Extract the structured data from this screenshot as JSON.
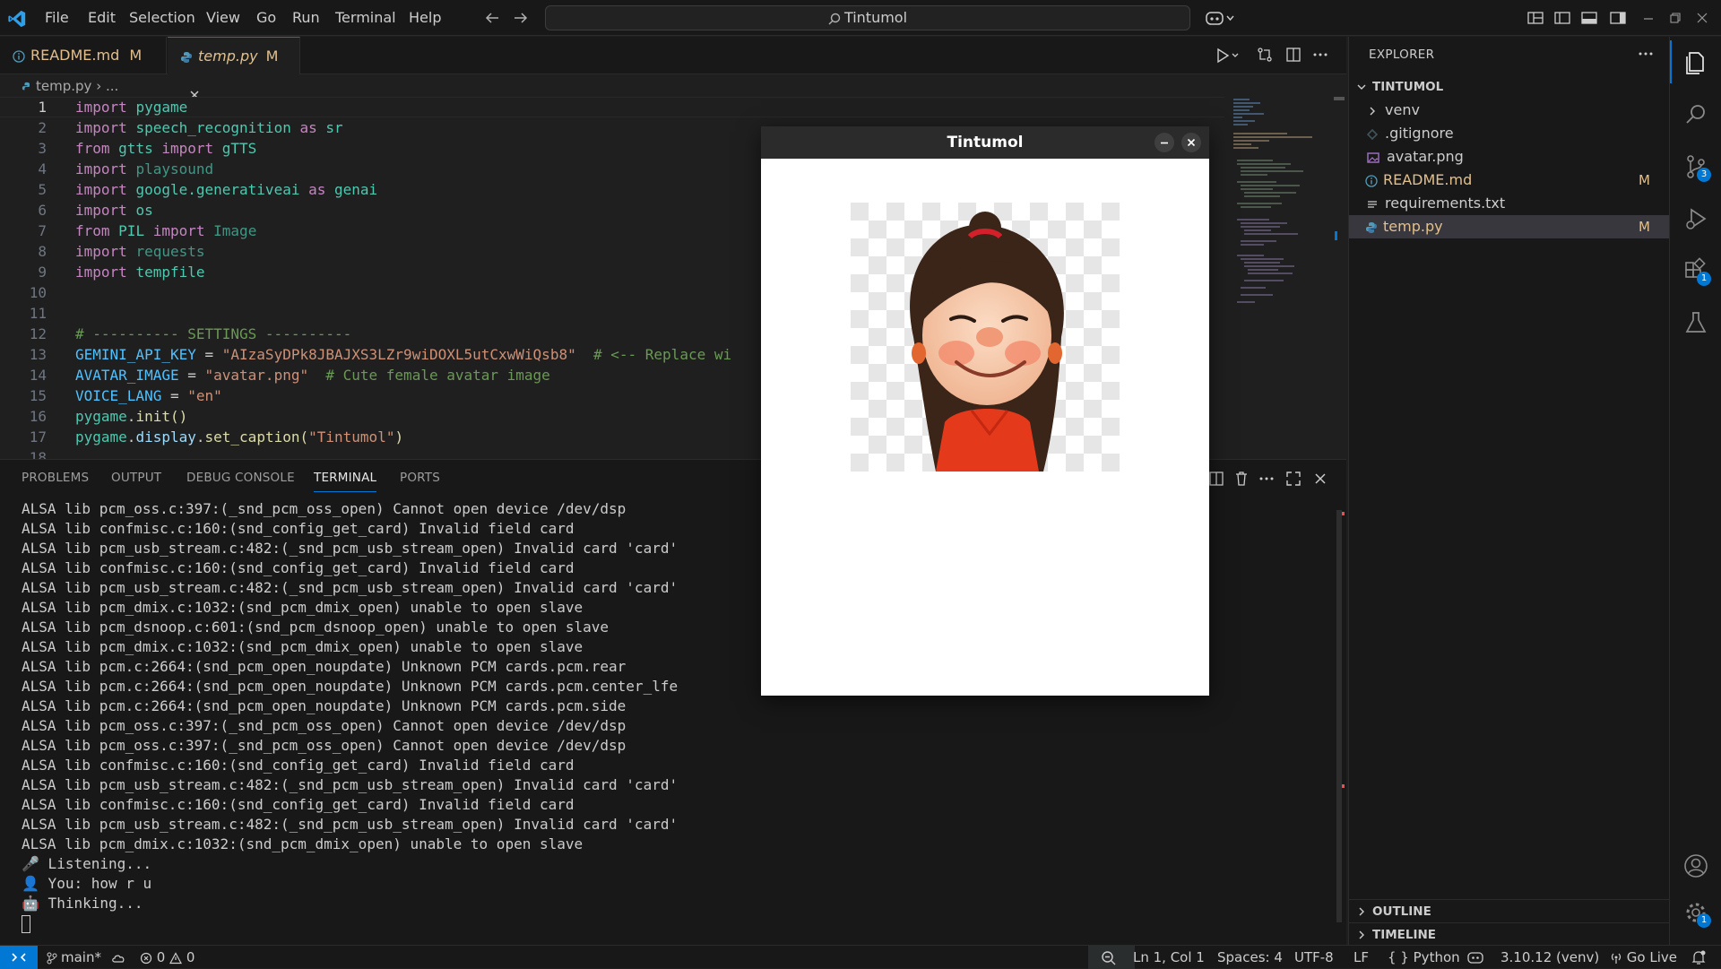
{
  "menu": [
    "File",
    "Edit",
    "Selection",
    "View",
    "Go",
    "Run",
    "Terminal",
    "Help"
  ],
  "command_center": "Tintumol",
  "tabs": [
    {
      "label": "README.md",
      "badge": "M"
    },
    {
      "label": "temp.py",
      "badge": "M"
    }
  ],
  "breadcrumb": {
    "file": "temp.py",
    "rest": "..."
  },
  "code": {
    "lines": [
      "1",
      "2",
      "3",
      "4",
      "5",
      "6",
      "7",
      "8",
      "9",
      "10",
      "11",
      "12",
      "13",
      "14",
      "15",
      "16",
      "17",
      "18"
    ],
    "l1": [
      "import",
      "pygame"
    ],
    "l2": [
      "import",
      "speech_recognition",
      "as",
      "sr"
    ],
    "l3": [
      "from",
      "gtts",
      "import",
      "gTTS"
    ],
    "l4": [
      "import",
      "playsound"
    ],
    "l5": [
      "import",
      "google.generativeai",
      "as",
      "genai"
    ],
    "l6": [
      "import",
      "os"
    ],
    "l7": [
      "from",
      "PIL",
      "import",
      "Image"
    ],
    "l8": [
      "import",
      "requests"
    ],
    "l9": [
      "import",
      "tempfile"
    ],
    "l12": "# ---------- SETTINGS ----------",
    "l13": [
      "GEMINI_API_KEY",
      " = ",
      "\"AIzaSyDPk8JBAJXS3LZr9wiDOXL5utCxwWiQsb8\"",
      "  # <-- Replace wi"
    ],
    "l14": [
      "AVATAR_IMAGE",
      " = ",
      "\"avatar.png\"",
      "  # Cute female avatar image"
    ],
    "l15": [
      "VOICE_LANG",
      " = ",
      "\"en\""
    ],
    "l16": [
      "pygame",
      ".",
      "init",
      "()"
    ],
    "l17": [
      "pygame",
      ".",
      "display",
      ".",
      "set_caption",
      "(",
      "\"Tintumol\"",
      ")"
    ]
  },
  "panel": {
    "tabs": [
      "PROBLEMS",
      "OUTPUT",
      "DEBUG CONSOLE",
      "TERMINAL",
      "PORTS"
    ],
    "terminal": [
      "ALSA lib pcm_oss.c:397:(_snd_pcm_oss_open) Cannot open device /dev/dsp",
      "ALSA lib confmisc.c:160:(snd_config_get_card) Invalid field card",
      "ALSA lib pcm_usb_stream.c:482:(_snd_pcm_usb_stream_open) Invalid card 'card'",
      "ALSA lib confmisc.c:160:(snd_config_get_card) Invalid field card",
      "ALSA lib pcm_usb_stream.c:482:(_snd_pcm_usb_stream_open) Invalid card 'card'",
      "ALSA lib pcm_dmix.c:1032:(snd_pcm_dmix_open) unable to open slave",
      "ALSA lib pcm_dsnoop.c:601:(snd_pcm_dsnoop_open) unable to open slave",
      "ALSA lib pcm_dmix.c:1032:(snd_pcm_dmix_open) unable to open slave",
      "ALSA lib pcm.c:2664:(snd_pcm_open_noupdate) Unknown PCM cards.pcm.rear",
      "ALSA lib pcm.c:2664:(snd_pcm_open_noupdate) Unknown PCM cards.pcm.center_lfe",
      "ALSA lib pcm.c:2664:(snd_pcm_open_noupdate) Unknown PCM cards.pcm.side",
      "ALSA lib pcm_oss.c:397:(_snd_pcm_oss_open) Cannot open device /dev/dsp",
      "ALSA lib pcm_oss.c:397:(_snd_pcm_oss_open) Cannot open device /dev/dsp",
      "ALSA lib confmisc.c:160:(snd_config_get_card) Invalid field card",
      "ALSA lib pcm_usb_stream.c:482:(_snd_pcm_usb_stream_open) Invalid card 'card'",
      "ALSA lib confmisc.c:160:(snd_config_get_card) Invalid field card",
      "ALSA lib pcm_usb_stream.c:482:(_snd_pcm_usb_stream_open) Invalid card 'card'",
      "ALSA lib pcm_dmix.c:1032:(snd_pcm_dmix_open) unable to open slave",
      "🎤 Listening...",
      "👤 You: how r u",
      "🤖 Thinking..."
    ]
  },
  "explorer": {
    "title": "EXPLORER",
    "folder": "TINTUMOL",
    "items": [
      {
        "label": "venv"
      },
      {
        "label": ".gitignore"
      },
      {
        "label": "avatar.png"
      },
      {
        "label": "README.md",
        "badge": "M"
      },
      {
        "label": "requirements.txt"
      },
      {
        "label": "temp.py",
        "badge": "M"
      }
    ],
    "outline": "OUTLINE",
    "timeline": "TIMELINE"
  },
  "activity_badges": {
    "source_control": "3",
    "extensions": "1",
    "settings": "1"
  },
  "statusbar": {
    "branch": "main*",
    "errors": "0",
    "warnings": "0",
    "position": "Ln 1, Col 1",
    "spaces": "Spaces: 4",
    "encoding": "UTF-8",
    "eol": "LF",
    "language": "Python",
    "interpreter": "3.10.12 (venv)",
    "golive": "Go Live"
  },
  "pygame_window": {
    "title": "Tintumol"
  },
  "colors": {
    "accent": "#0078d4",
    "modified": "#e2c08d",
    "remote": "#0078d4"
  }
}
